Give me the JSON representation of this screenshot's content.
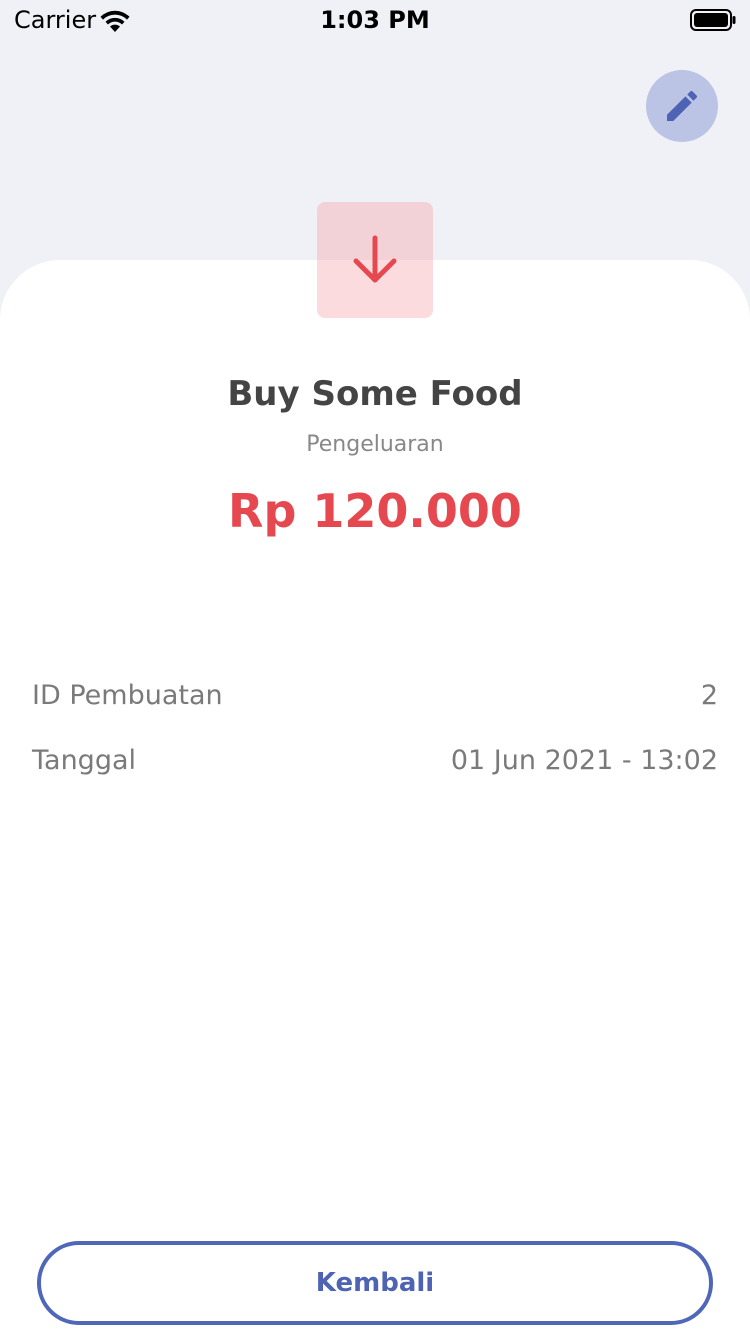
{
  "status_bar": {
    "carrier": "Carrier",
    "time": "1:03 PM"
  },
  "icons": {
    "edit": "pencil-icon",
    "type": "arrow-down-icon",
    "wifi": "wifi-icon",
    "battery": "battery-icon"
  },
  "transaction": {
    "title": "Buy Some Food",
    "category": "Pengeluaran",
    "amount": "Rp 120.000"
  },
  "details": [
    {
      "label": "ID Pembuatan",
      "value": "2"
    },
    {
      "label": "Tanggal",
      "value": "01 Jun 2021 - 13:02"
    }
  ],
  "actions": {
    "back_label": "Kembali"
  },
  "colors": {
    "accent": "#4e63b3",
    "expense": "#e5484f",
    "background": "#f0f1f6"
  }
}
